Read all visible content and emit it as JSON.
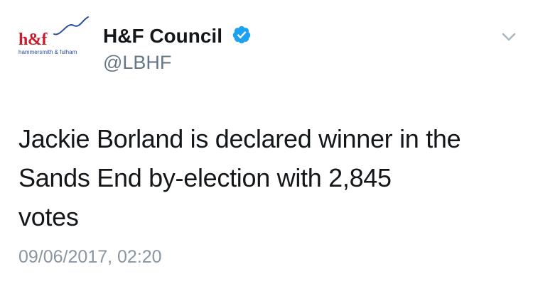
{
  "account": {
    "logo_text": "h&f",
    "logo_subtext": "hammersmith & fulham",
    "display_name": "H&F Council",
    "handle": "@LBHF",
    "verified": true
  },
  "tweet": {
    "text_lines": [
      "Jackie Borland is declared winner in the",
      "Sands End by-election with 2,845",
      "votes"
    ],
    "timestamp": "09/06/2017, 02:20"
  },
  "icons": {
    "verified": "verified-badge-icon",
    "caret": "chevron-down-icon"
  },
  "colors": {
    "brand_red": "#c41f2e",
    "brand_blue": "#2a4da0",
    "verified_blue": "#1da1f2",
    "muted_text": "#657786"
  }
}
